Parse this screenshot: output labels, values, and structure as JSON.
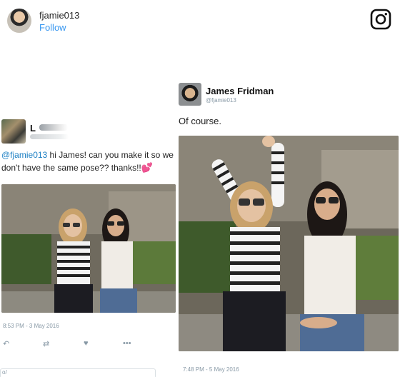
{
  "instagram": {
    "username": "fjamie013",
    "follow_label": "Follow"
  },
  "left_tweet": {
    "name_visible": "L",
    "mention": "@fjamie013",
    "text": " hi James! can you make it so we don't have the same pose?? thanks!!",
    "heart": "💕",
    "timestamp": "8:53 PM - 3 May 2016",
    "reply_box_text": "o/",
    "icons": [
      "reply-icon",
      "retweet-icon",
      "like-icon",
      "more-icon"
    ]
  },
  "right_tweet": {
    "name": "James Fridman",
    "handle": "@fjamie013",
    "text": "Of course.",
    "timestamp": "7:48 PM - 5 May 2016"
  },
  "colors": {
    "link_blue": "#3897f0",
    "mention_blue": "#1b7fc3",
    "muted_gray": "#8899a6"
  }
}
